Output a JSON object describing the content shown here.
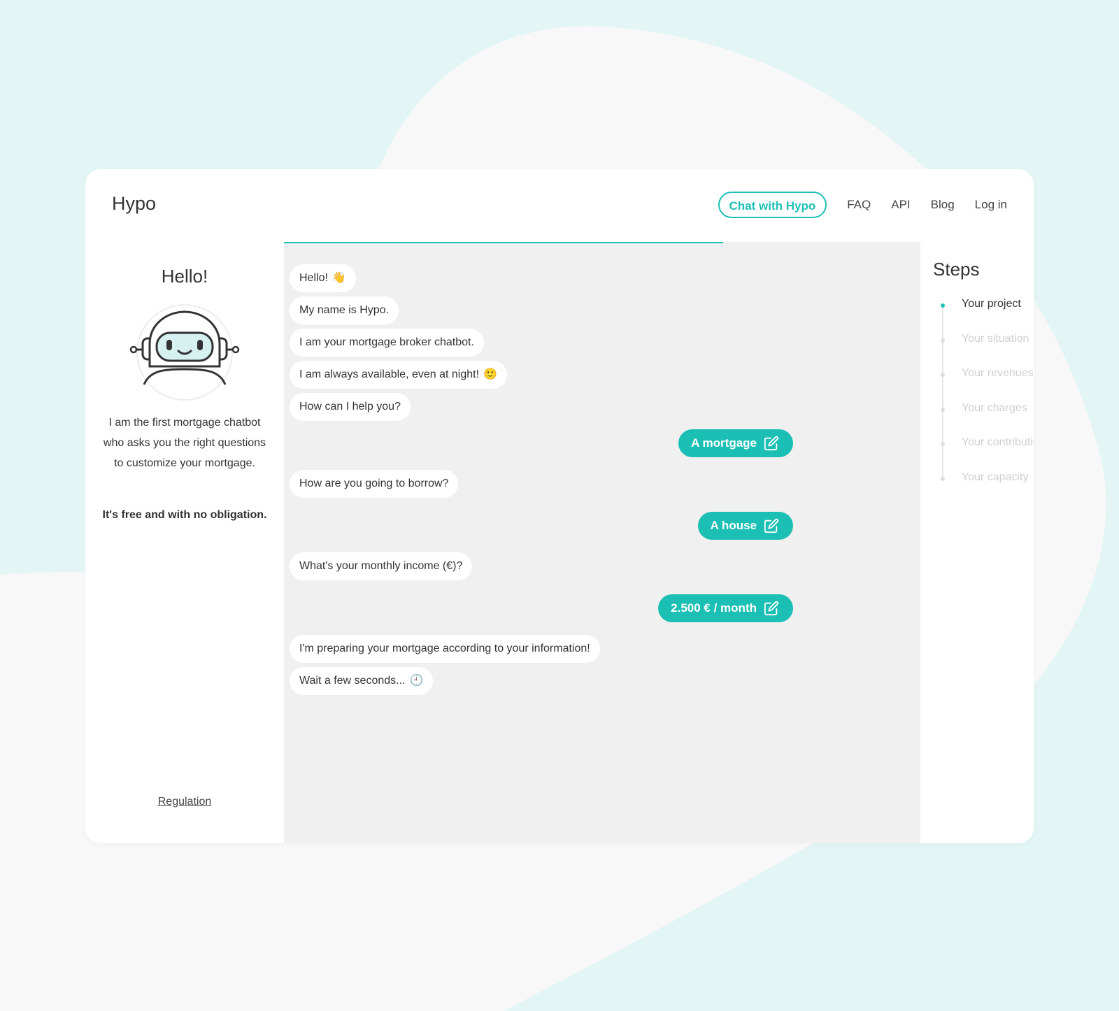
{
  "header": {
    "logo": "Hypo",
    "nav": {
      "chat_button": "Chat with Hypo",
      "links": [
        "FAQ",
        "API",
        "Blog",
        "Log in"
      ]
    }
  },
  "progress": {
    "fraction": 0.69
  },
  "left_panel": {
    "title": "Hello!",
    "intro": "I am the first mortgage chatbot who asks you the right questions to customize your mortgage.",
    "tagline": "It's free and with no obligation.",
    "regulation_link": "Regulation"
  },
  "chat": {
    "greeting": [
      {
        "text": "Hello!",
        "emoji": "👋"
      },
      {
        "text": "My name is Hypo.",
        "emoji": ""
      },
      {
        "text": "I am your mortgage broker chatbot.",
        "emoji": ""
      },
      {
        "text": "I am always available, even at night!",
        "emoji": "🙂"
      },
      {
        "text": "How can I help you?",
        "emoji": ""
      }
    ],
    "answer_1": "A mortgage",
    "question_2": "How are you going to borrow?",
    "answer_2": "A house",
    "question_3": "What's your monthly income (€)?",
    "answer_3": "2.500 € / month",
    "closing": [
      {
        "text": "I'm preparing your mortgage according to your information!",
        "emoji": ""
      },
      {
        "text": "Wait a few seconds...",
        "emoji": "🕘"
      }
    ],
    "edit_icon": "edit-icon"
  },
  "steps": {
    "title": "Steps",
    "items": [
      {
        "label": "Your project",
        "active": true
      },
      {
        "label": "Your situation",
        "active": false
      },
      {
        "label": "Your revenues",
        "active": false
      },
      {
        "label": "Your charges",
        "active": false
      },
      {
        "label": "Your contribution",
        "active": false
      },
      {
        "label": "Your capacity",
        "active": false
      }
    ]
  },
  "colors": {
    "accent": "#1bbfb4",
    "background": "#e4f5f5",
    "chat_background": "#f0f0f0"
  }
}
